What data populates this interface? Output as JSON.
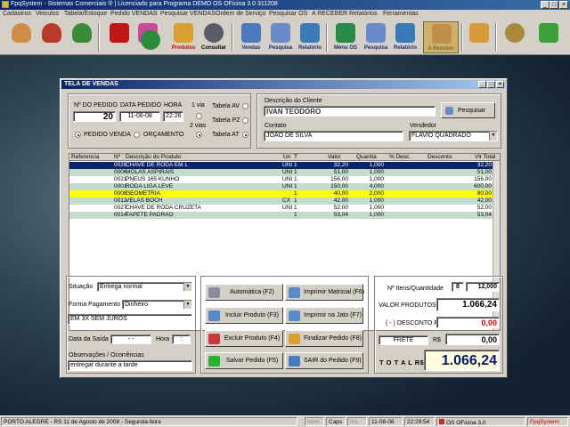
{
  "window": {
    "title": "FpqSystem - Sistemas Comerciais ® | Licenciado para  Programa DEMO OS OFicina 3.0 311208"
  },
  "menu": [
    "Cadastros",
    "Veiculos",
    "Tabela/Estoque",
    "Pedido VENDAS",
    "Pesquisar VENDAS",
    "Ordem de Serviço",
    "Pesquisar OS",
    "A RECEBER",
    "Relatórios",
    "Ferramentas"
  ],
  "toolbar": [
    {
      "label": "",
      "icon": "person-icon",
      "color": "#d08a4a"
    },
    {
      "label": "",
      "icon": "person-red-icon",
      "color": "#b83a2a"
    },
    {
      "label": "",
      "icon": "person-green-icon",
      "color": "#3a8a3a"
    },
    {
      "label": "",
      "icon": "car-icon",
      "color": "#c01818"
    },
    {
      "label": "",
      "icon": "gift-icon",
      "color": "#c84b9a"
    },
    {
      "label": "",
      "icon": "clock-icon",
      "color": "#2c8a3c"
    },
    {
      "label": "Produtos",
      "icon": "boxes-icon",
      "color": "#d8a030"
    },
    {
      "label": "Consultar",
      "icon": "barcode-icon",
      "color": "#5a5a6a"
    },
    {
      "label": "Vendas",
      "icon": "monitor-icon",
      "color": "#4a7ac0"
    },
    {
      "label": "Pesquisa",
      "icon": "search-doc-icon",
      "color": "#6a8ac8"
    },
    {
      "label": "Relatório",
      "icon": "report-icon",
      "color": "#3a7ab8"
    },
    {
      "label": "Menu OS",
      "icon": "os-menu-icon",
      "color": "#2a8a4a"
    },
    {
      "label": "Pesquisa",
      "icon": "search-doc-icon",
      "color": "#6a8ac8"
    },
    {
      "label": "Relatório",
      "icon": "report-icon",
      "color": "#3a7ab8"
    },
    {
      "label": "A Receber",
      "icon": "tools-icon",
      "color": "#c0904a"
    },
    {
      "label": "",
      "icon": "calculator-icon",
      "color": "#d89a3a"
    },
    {
      "label": "",
      "icon": "coin-icon",
      "color": "#a88a3a"
    },
    {
      "label": "",
      "icon": "exit-icon",
      "color": "#3aa03a"
    }
  ],
  "dialog": {
    "title": "TELA DE VENDAS",
    "pedido": {
      "label_num": "Nº DO PEDIDO",
      "label_data": "DATA PEDIDO",
      "label_hora": "HORA",
      "num": "20",
      "data": "11-08-08",
      "hora": "22:26",
      "radio_venda": "PEDIDO VENDA",
      "radio_orc": "ORÇAMENTO",
      "via1": "1 via",
      "via2": "2 vias"
    },
    "tabelas": [
      "Tabela AV",
      "Tabela PZ",
      "Tabela AT"
    ],
    "cliente": {
      "label": "Descrição do Cliente",
      "value": "IVAN TEODORO",
      "btn": "Pesquisar",
      "contato_label": "Contato",
      "contato": "JOÃO DE SILVA",
      "vendedor_label": "Vendedor",
      "vendedor": "FLAVIO QUADRADO"
    },
    "grid": {
      "headers": [
        "Referencia",
        "Nº",
        "Descrição do Produto",
        "Un",
        "T",
        "Valor",
        "Quantia",
        "% Desc.",
        "Desconto",
        "Vlr Total"
      ],
      "rows": [
        {
          "n": "0026",
          "desc": "CHAVE DE RODA EM L",
          "un": "UNI",
          "t": "1",
          "valor": "32,20",
          "qtd": "1,000",
          "total": "32,20",
          "style": "sel"
        },
        {
          "n": "0006",
          "desc": "MOLAS ASPIRAIS",
          "un": "UNI",
          "t": "1",
          "valor": "51,00",
          "qtd": "1,000",
          "total": "51,00",
          "style": "g"
        },
        {
          "n": "0021",
          "desc": "PNEUS 165 KUNHO",
          "un": "UNI",
          "t": "1",
          "valor": "156,00",
          "qtd": "1,000",
          "total": "156,00",
          "style": "w"
        },
        {
          "n": "0001",
          "desc": "RODA LIGA LEVE",
          "un": "UNI",
          "t": "1",
          "valor": "150,00",
          "qtd": "4,000",
          "total": "600,00",
          "style": "g"
        },
        {
          "n": "0008",
          "desc": "GEOMETRIA",
          "un": "",
          "t": "1",
          "valor": "40,00",
          "qtd": "2,000",
          "total": "80,00",
          "style": "y"
        },
        {
          "n": "0012",
          "desc": "VELAS BOCH",
          "un": "CX",
          "t": "1",
          "valor": "42,00",
          "qtd": "1,000",
          "total": "42,00",
          "style": "g"
        },
        {
          "n": "0027",
          "desc": "CHAVE DE RODA CRUZETA",
          "un": "UNI",
          "t": "1",
          "valor": "52,00",
          "qtd": "1,000",
          "total": "52,00",
          "style": "w"
        },
        {
          "n": "0014",
          "desc": "TAPETE PADRAO",
          "un": "",
          "t": "1",
          "valor": "53,04",
          "qtd": "1,000",
          "total": "53,04",
          "style": "g"
        }
      ]
    },
    "left": {
      "situacao_label": "Situação",
      "situacao": "Entrega normal",
      "forma_label": "Forma Pagamento",
      "forma": "Dinheiro",
      "condicao": "EM 3X SEM JUROS",
      "saida_label": "Data da Saída",
      "saida": "  -  -  ",
      "hora_label": "Hora",
      "hora": " : ",
      "obs_label": "Observações / Ocorrências",
      "obs": "entregar durante a tarde"
    },
    "buttons": [
      {
        "label": "Automática    (F2)",
        "color": "#8a8aa0"
      },
      {
        "label": "Imprimir Matricial  (F6)",
        "color": "#5a8ac8"
      },
      {
        "label": "Incluir Produto  (F3)",
        "color": "#5a8ac8"
      },
      {
        "label": "Imprimir na Jato  (F7)",
        "color": "#5a8ac8"
      },
      {
        "label": "Excluir Produto  (F4)",
        "color": "#c83a3a"
      },
      {
        "label": "Finalizar Pedido  (F8)",
        "color": "#d8a030"
      },
      {
        "label": "Salvar Pedido   (F5)",
        "color": "#2ab030"
      },
      {
        "label": "SAIR do Pedido   (F9)",
        "color": "#4a7ac0"
      }
    ],
    "totals": {
      "itens_label": "Nº Itens/Quantidade",
      "itens": "8",
      "quantidade": "12,000",
      "prod_label": "VALOR PRODUTOS R$",
      "prod": "1.066,24",
      "desc_label": "( - ) DESCONTO R$",
      "desc": "0,00",
      "frete_label": "FRETE",
      "frete_rs": "R$",
      "frete": "0,00",
      "total_label": "T O T A L  R$",
      "total": "1.066,24"
    }
  },
  "statusbar": {
    "city": "PORTO ALEGRE - RS 11 de Agosto de 2008 - Segunda-feira",
    "num": "Num",
    "caps": "Caps",
    "ins": "Ins",
    "date": "11-08-08",
    "time": "22:29:54",
    "prog": "OS OFicina 3.0",
    "brand": "FpqSystem"
  }
}
